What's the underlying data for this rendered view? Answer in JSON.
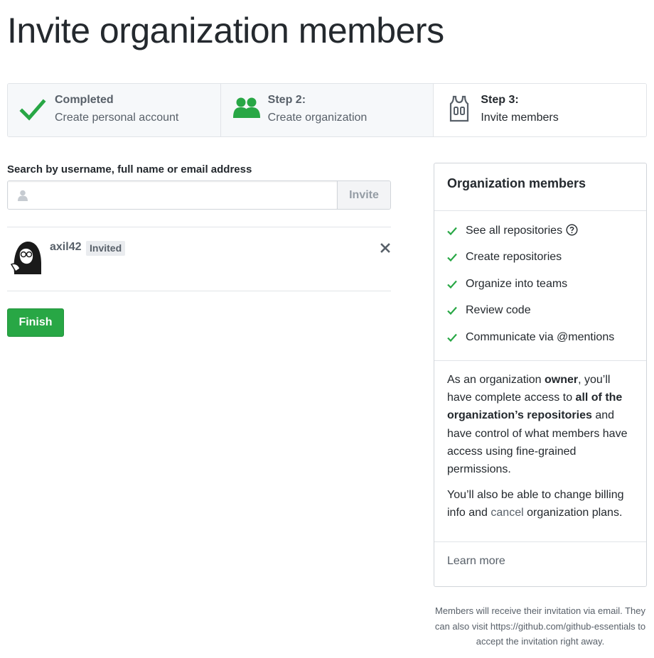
{
  "page": {
    "title": "Invite organization members"
  },
  "steps": [
    {
      "title": "Completed",
      "subtitle": "Create personal account",
      "icon": "check-icon"
    },
    {
      "title": "Step 2:",
      "subtitle": "Create organization",
      "icon": "people-icon"
    },
    {
      "title": "Step 3:",
      "subtitle": "Invite members",
      "icon": "jersey-icon"
    }
  ],
  "search": {
    "label": "Search by username, full name or email address",
    "value": "",
    "placeholder": "",
    "invite_label": "Invite"
  },
  "members": [
    {
      "username": "axil42",
      "badge": "Invited"
    }
  ],
  "finish_label": "Finish",
  "sidebar": {
    "title": "Organization members",
    "features": [
      "See all repositories",
      "Create repositories",
      "Organize into teams",
      "Review code",
      "Communicate via @mentions"
    ],
    "owner_para": {
      "t1": "As an organization ",
      "b1": "owner",
      "t2": ", you’ll have complete access to ",
      "b2": "all of the organization’s repositories",
      "t3": " and have control of what members have access using fine-grained permissions."
    },
    "billing_para": {
      "t1": "You’ll also be able to change billing info and ",
      "link": "cancel",
      "t2": " organization plans."
    },
    "learn_more": "Learn more"
  },
  "footnote": "Members will receive their invitation via email. They can also visit https://github.com/github-essentials to accept the invitation right away.",
  "colors": {
    "accent_green": "#28a745",
    "text_primary": "#24292e",
    "text_muted": "#586069",
    "border": "#e1e4e8"
  }
}
